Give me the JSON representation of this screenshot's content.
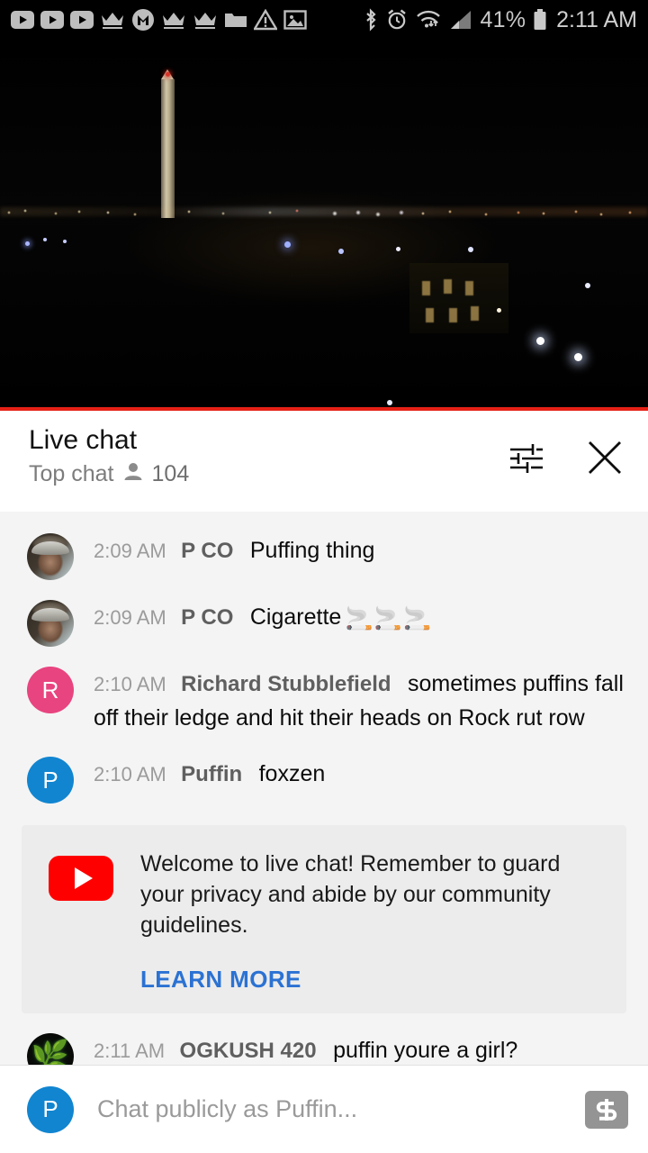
{
  "status_bar": {
    "battery_percent": "41%",
    "time": "2:11 AM",
    "icons": [
      "youtube-notification-icon",
      "youtube-notification-icon",
      "youtube-notification-icon",
      "crown-icon",
      "m-badge-icon",
      "crown-icon",
      "crown-icon",
      "folder-icon",
      "warning-triangle-icon",
      "image-icon",
      "bluetooth-icon",
      "alarm-icon",
      "wifi-icon",
      "cell-signal-icon",
      "battery-icon"
    ]
  },
  "video": {
    "name": "live-stream-washington-monument-night",
    "progress_color": "#e62117"
  },
  "chat_header": {
    "title": "Live chat",
    "mode": "Top chat",
    "viewer_count": "104",
    "viewer_icon": "person-icon",
    "filter_icon": "tune-filter-icon",
    "close_icon": "close-x-icon"
  },
  "messages": [
    {
      "time": "2:09 AM",
      "author": "P CO",
      "text": "Puffing thing",
      "emoji": "",
      "avatar_type": "photo-man",
      "avatar_letter": "",
      "avatar_color": ""
    },
    {
      "time": "2:09 AM",
      "author": "P CO",
      "text": "Cigarette",
      "emoji": "🚬🚬🚬",
      "avatar_type": "photo-man",
      "avatar_letter": "",
      "avatar_color": ""
    },
    {
      "time": "2:10 AM",
      "author": "Richard Stubblefield",
      "text": "sometimes puffins fall off their ledge and hit their heads on Rock rut row",
      "emoji": "",
      "avatar_type": "letter",
      "avatar_letter": "R",
      "avatar_color": "#e8447f"
    },
    {
      "time": "2:10 AM",
      "author": "Puffin",
      "text": "foxzen",
      "emoji": "",
      "avatar_type": "letter",
      "avatar_letter": "P",
      "avatar_color": "#1185d0"
    }
  ],
  "welcome_card": {
    "icon": "youtube-logo-icon",
    "text": "Welcome to live chat! Remember to guard your privacy and abide by our community guidelines.",
    "link_label": "LEARN MORE",
    "link_color": "#2b72d3",
    "background": "#ececec"
  },
  "messages_after_card": [
    {
      "time": "2:11 AM",
      "author": "OGKUSH 420",
      "text": "puffin youre a girl?",
      "emoji": "",
      "avatar_type": "leaf",
      "avatar_letter": "",
      "avatar_color": "#0a0f0a"
    }
  ],
  "input_bar": {
    "avatar_letter": "P",
    "avatar_color": "#1185d0",
    "placeholder": "Chat publicly as Puffin...",
    "superchat_label": "$",
    "superchat_icon": "super-chat-dollar-icon"
  }
}
